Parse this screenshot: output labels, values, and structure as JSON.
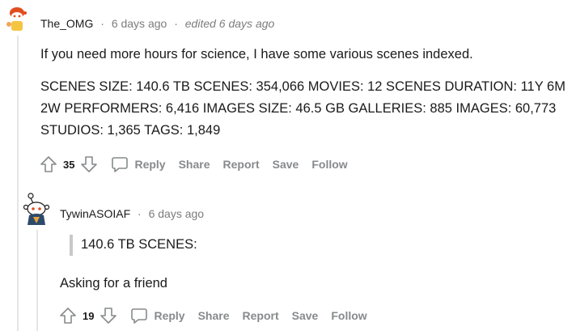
{
  "comment1": {
    "username": "The_OMG",
    "time": "6 days ago",
    "edited": "edited 6 days ago",
    "separator": "·",
    "paragraph1": "If you need more hours for science, I have some various scenes indexed.",
    "paragraph2_line1": "SCENES SIZE: 140.6 TB SCENES: 354,066 MOVIES: 12 SCENES DURATION: 11Y 6M",
    "paragraph2_line2": "2W PERFORMERS: 6,416 IMAGES SIZE: 46.5 GB GALLERIES: 885 IMAGES: 60,773",
    "paragraph2_line3": "STUDIOS: 1,365 TAGS: 1,849",
    "score": "35",
    "actions": {
      "reply": "Reply",
      "share": "Share",
      "report": "Report",
      "save": "Save",
      "follow": "Follow"
    }
  },
  "comment2": {
    "username": "TywinASOIAF",
    "time": "6 days ago",
    "separator": "·",
    "quote": "140.6 TB SCENES:",
    "text": "Asking for a friend",
    "score": "19",
    "actions": {
      "reply": "Reply",
      "share": "Share",
      "report": "Report",
      "save": "Save",
      "follow": "Follow"
    }
  },
  "colors": {
    "meta": "#7c7c7c",
    "action": "#878a8c",
    "text": "#1a1a1b",
    "thread_line": "#e6e6e6"
  }
}
